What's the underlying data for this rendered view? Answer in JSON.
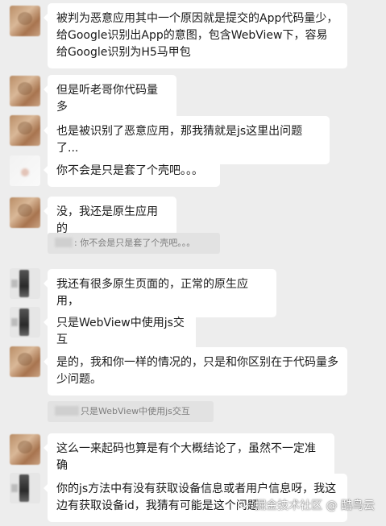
{
  "messages": [
    {
      "avatar": "tan",
      "text": "被判为恶意应用其中一个原因就是提交的App代码量少，给Google识别出App的意图，包含WebView下，容易给Google识别为H5马甲包"
    },
    {
      "avatar": "tan",
      "text": "但是听老哥你代码量多"
    },
    {
      "avatar": "tan",
      "text": "也是被识别了恶意应用，那我猜就是js这里出问题了..."
    },
    {
      "avatar": "light",
      "text": "你不会是只是套了个壳吧。。。"
    },
    {
      "avatar": "tan",
      "text": "没，我还是原生应用的"
    },
    {
      "avatar": "dark",
      "text": "我还有很多原生页面的，正常的原生应用，"
    },
    {
      "avatar": "dark",
      "text": "只是WebView中使用js交互"
    },
    {
      "avatar": "tan",
      "text": "是的，我和你一样的情况的，只是和你区别在于代码量多少问题。"
    },
    {
      "avatar": "tan",
      "text": "这么一来起码也算是有个大概结论了，虽然不一定准确"
    },
    {
      "avatar": "dark",
      "text": "你的js方法中有没有获取设备信息或者用户信息呀，我这边有获取设备id，我猜有可能是这个问题"
    }
  ],
  "quotes": [
    {
      "text": ": 你不会是只是套了个壳吧。。。"
    },
    {
      "text": "只是WebView中使用js交互"
    }
  ],
  "watermark": {
    "text": "掘金技术社区 @ 酷鸟云",
    "icon": "juejin-logo-icon"
  }
}
